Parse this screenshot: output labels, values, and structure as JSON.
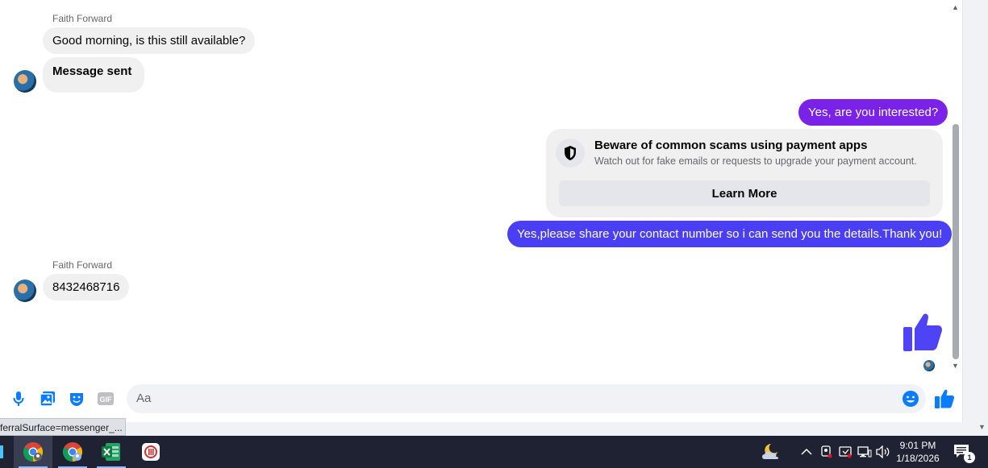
{
  "messages": [
    {
      "sender": "Faith Forward",
      "text": "Good morning, is this still available?",
      "direction": "incoming"
    },
    {
      "text": "Message sent",
      "direction": "incoming"
    },
    {
      "text": "Yes, are you interested?",
      "direction": "outgoing"
    },
    {
      "text": "Yes,please share your contact number so i can send you the details.Thank you!",
      "direction": "outgoing"
    },
    {
      "sender": "Faith Forward",
      "text": "8432468716",
      "direction": "incoming"
    }
  ],
  "scam_warning": {
    "title": "Beware of common scams using payment apps",
    "description": "Watch out for fake emails or requests to upgrade your payment account.",
    "button": "Learn More"
  },
  "composer": {
    "placeholder": "Aa"
  },
  "composer_tools": {
    "gif_label": "GIF"
  },
  "status_url": "ferralSurface=messenger_...",
  "taskbar": {
    "time": "9:01 PM",
    "date": "1/18/2026",
    "notification_count": "1"
  },
  "colors": {
    "outgoing_purple": "#7a22e8",
    "outgoing_blue": "#4b3ff5",
    "accent": "#0a7cff",
    "like_icon": "#4e43f5"
  }
}
